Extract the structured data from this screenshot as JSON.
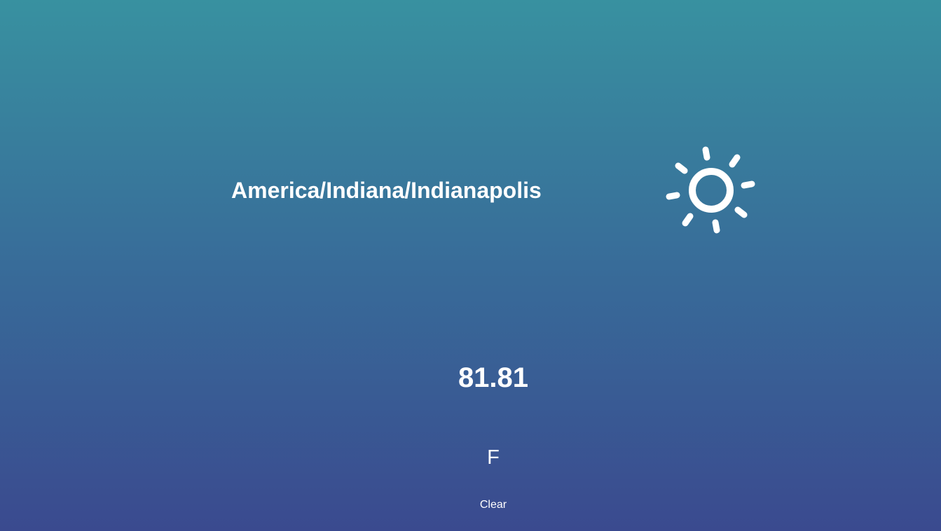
{
  "location": {
    "timezone": "America/Indiana/Indianapolis"
  },
  "weather": {
    "icon": "sun-icon",
    "temperature": "81.81",
    "unit": "F",
    "summary": "Clear"
  },
  "colors": {
    "background_top": "#3891a0",
    "background_bottom": "#3a4a8f",
    "text": "#ffffff"
  }
}
